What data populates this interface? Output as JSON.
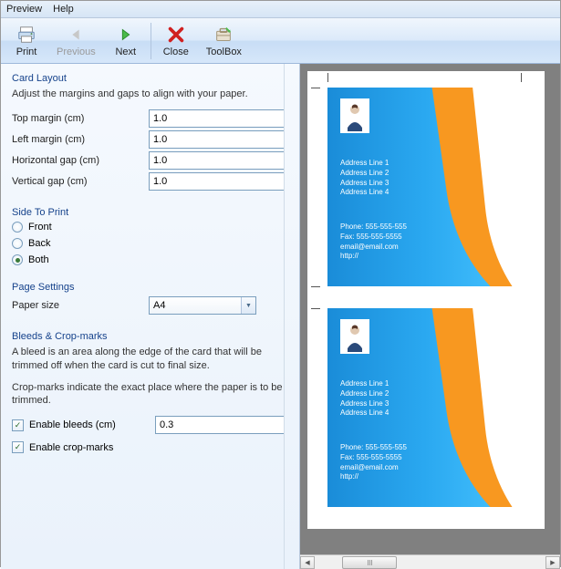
{
  "menu": {
    "preview": "Preview",
    "help": "Help"
  },
  "toolbar": {
    "print": "Print",
    "previous": "Previous",
    "next": "Next",
    "close": "Close",
    "toolbox": "ToolBox"
  },
  "cardLayout": {
    "title": "Card Layout",
    "desc": "Adjust the margins and gaps to align with your paper.",
    "topMarginLabel": "Top margin (cm)",
    "topMargin": "1.0",
    "leftMarginLabel": "Left margin (cm)",
    "leftMargin": "1.0",
    "hGapLabel": "Horizontal gap (cm)",
    "hGap": "1.0",
    "vGapLabel": "Vertical gap (cm)",
    "vGap": "1.0"
  },
  "sideToPrint": {
    "title": "Side To Print",
    "front": "Front",
    "back": "Back",
    "both": "Both",
    "selected": "both"
  },
  "pageSettings": {
    "title": "Page Settings",
    "paperSizeLabel": "Paper size",
    "paperSize": "A4"
  },
  "bleeds": {
    "title": "Bleeds & Crop-marks",
    "desc1": "A bleed is an area along the edge of the card that will be trimmed off when the card is cut to final size.",
    "desc2": "Crop-marks indicate the exact place where the paper is to be trimmed.",
    "enableBleedsLabel": "Enable bleeds (cm)",
    "bleedValue": "0.3",
    "enableCropLabel": "Enable crop-marks",
    "bleedsChecked": true,
    "cropChecked": true
  },
  "card": {
    "addr1": "Address Line 1",
    "addr2": "Address Line 2",
    "addr3": "Address Line 3",
    "addr4": "Address Line 4",
    "phone": "Phone: 555-555-555",
    "fax": "Fax: 555-555-5555",
    "email": "email@email.com",
    "url": "http://"
  }
}
